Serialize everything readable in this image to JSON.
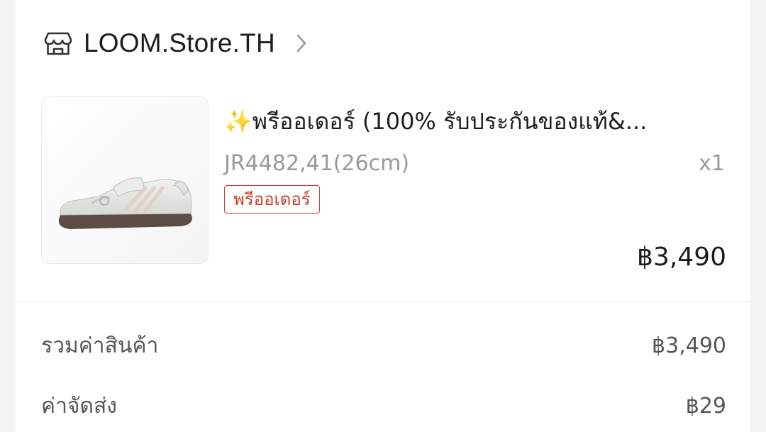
{
  "store": {
    "name": "LOOM.Store.TH",
    "icon": "store-icon",
    "chevron_icon": "chevron-right-icon"
  },
  "product": {
    "title": "✨พรีออเดอร์ (100% รับประกันของแท้&...",
    "variant": "JR4482,41(26cm)",
    "quantity": "x1",
    "badge": "พรีออเดอร์",
    "price": "฿3,490",
    "image": "shoe-image"
  },
  "summary": {
    "subtotal_label": "รวมค่าสินค้า",
    "subtotal_value": "฿3,490",
    "shipping_label": "ค่าจัดส่ง",
    "shipping_value": "฿29"
  },
  "colors": {
    "accent": "#c8412b",
    "background": "#f3f3f3",
    "card": "#ffffff"
  }
}
